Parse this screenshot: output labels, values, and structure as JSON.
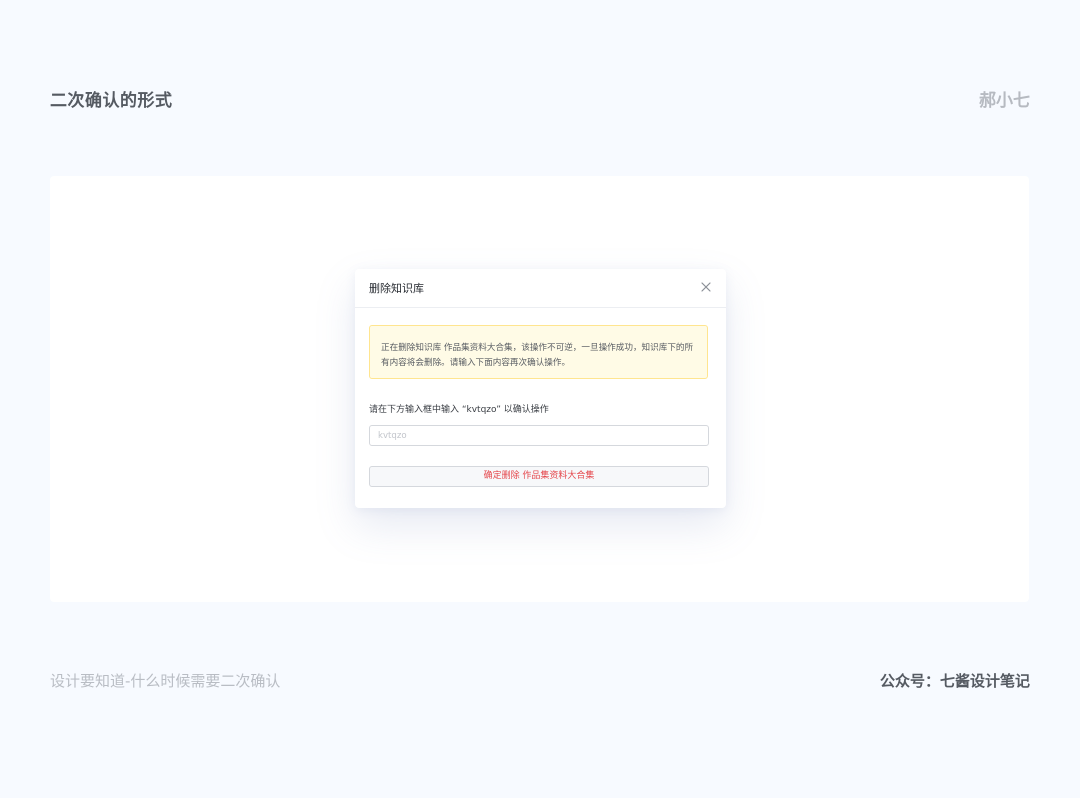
{
  "header": {
    "title": "二次确认的形式",
    "author": "郝小七"
  },
  "dialog": {
    "title": "删除知识库",
    "close_icon": "close-icon",
    "warning_text": "正在删除知识库 作品集资料大合集，该操作不可逆，一旦操作成功，知识库下的所有内容将会删除。请输入下面内容再次确认操作。",
    "prompt_text": "请在下方输入框中输入 “kvtqzo” 以确认操作",
    "input": {
      "value": "",
      "placeholder": "kvtqzo"
    },
    "confirm_button_label": "确定删除 作品集资料大合集",
    "colors": {
      "warning_bg": "#fffbe6",
      "warning_border": "#ffe58f",
      "danger": "#e5484d"
    }
  },
  "footer": {
    "left_text": "设计要知道-什么时候需要二次确认",
    "right_text": "公众号：七酱设计笔记"
  }
}
